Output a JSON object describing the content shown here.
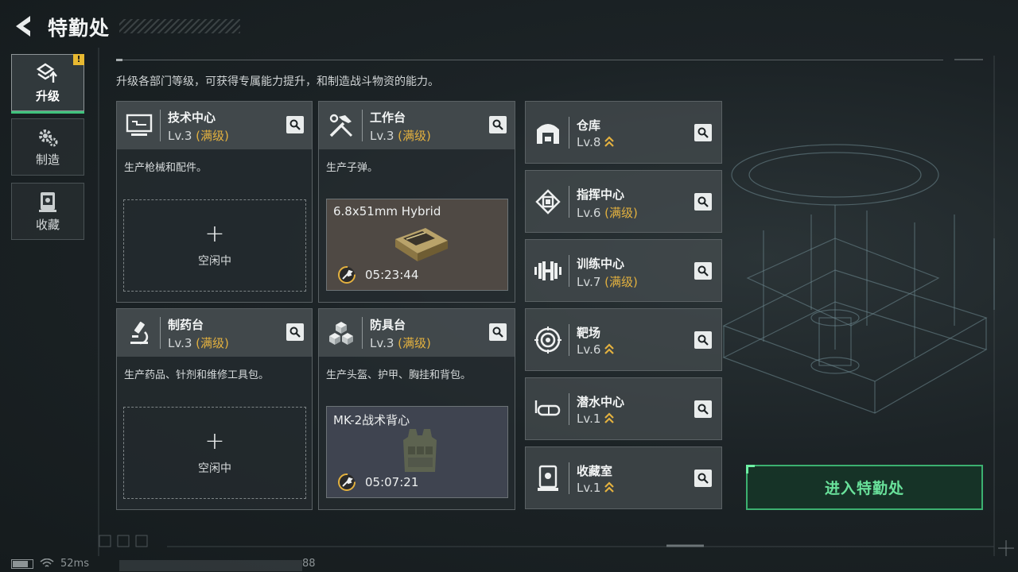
{
  "header": {
    "title": "特勤处"
  },
  "sidebar": {
    "items": [
      {
        "label": "升级",
        "icon": "upgrade-icon",
        "active": true,
        "badge": "!"
      },
      {
        "label": "制造",
        "icon": "gear-icon",
        "active": false
      },
      {
        "label": "收藏",
        "icon": "collection-icon",
        "active": false
      }
    ]
  },
  "description": "升级各部门等级，可获得专属能力提升，和制造战斗物资的能力。",
  "cards": [
    {
      "name": "技术中心",
      "level": "Lv.3",
      "max_tag": "(满级)",
      "desc": "生产枪械和配件。",
      "icon": "computer-icon",
      "slot": {
        "state": "idle",
        "plus": "+",
        "text": "空闲中"
      }
    },
    {
      "name": "工作台",
      "level": "Lv.3",
      "max_tag": "(满级)",
      "desc": "生产子弹。",
      "icon": "tools-icon",
      "slot": {
        "state": "producing",
        "item": "6.8x51mm Hybrid",
        "time": "05:23:44"
      }
    },
    {
      "name": "制药台",
      "level": "Lv.3",
      "max_tag": "(满级)",
      "desc": "生产药品、针剂和维修工具包。",
      "icon": "microscope-icon",
      "slot": {
        "state": "idle",
        "plus": "+",
        "text": "空闲中"
      }
    },
    {
      "name": "防具台",
      "level": "Lv.3",
      "max_tag": "(满级)",
      "desc": "生产头盔、护甲、胸挂和背包。",
      "icon": "cubes-icon",
      "slot": {
        "state": "producing",
        "item": "MK-2战术背心",
        "time": "05:07:21"
      }
    }
  ],
  "rooms": [
    {
      "name": "仓库",
      "level": "Lv.8",
      "max_tag": "",
      "upgradable": true,
      "icon": "warehouse-icon"
    },
    {
      "name": "指挥中心",
      "level": "Lv.6",
      "max_tag": "(满级)",
      "upgradable": false,
      "icon": "chip-icon"
    },
    {
      "name": "训练中心",
      "level": "Lv.7",
      "max_tag": "(满级)",
      "upgradable": false,
      "icon": "dumbbell-icon"
    },
    {
      "name": "靶场",
      "level": "Lv.6",
      "max_tag": "",
      "upgradable": true,
      "icon": "target-icon"
    },
    {
      "name": "潜水中心",
      "level": "Lv.1",
      "max_tag": "",
      "upgradable": true,
      "icon": "diving-mask-icon"
    },
    {
      "name": "收藏室",
      "level": "Lv.1",
      "max_tag": "",
      "upgradable": true,
      "icon": "display-case-icon"
    }
  ],
  "enter_button": "进入特勤处",
  "status": {
    "ping": "52ms",
    "num": "88"
  },
  "colors": {
    "accent_green": "#3fc27c",
    "max_gold": "#e3b13f",
    "badge_yellow": "#e8b931"
  }
}
